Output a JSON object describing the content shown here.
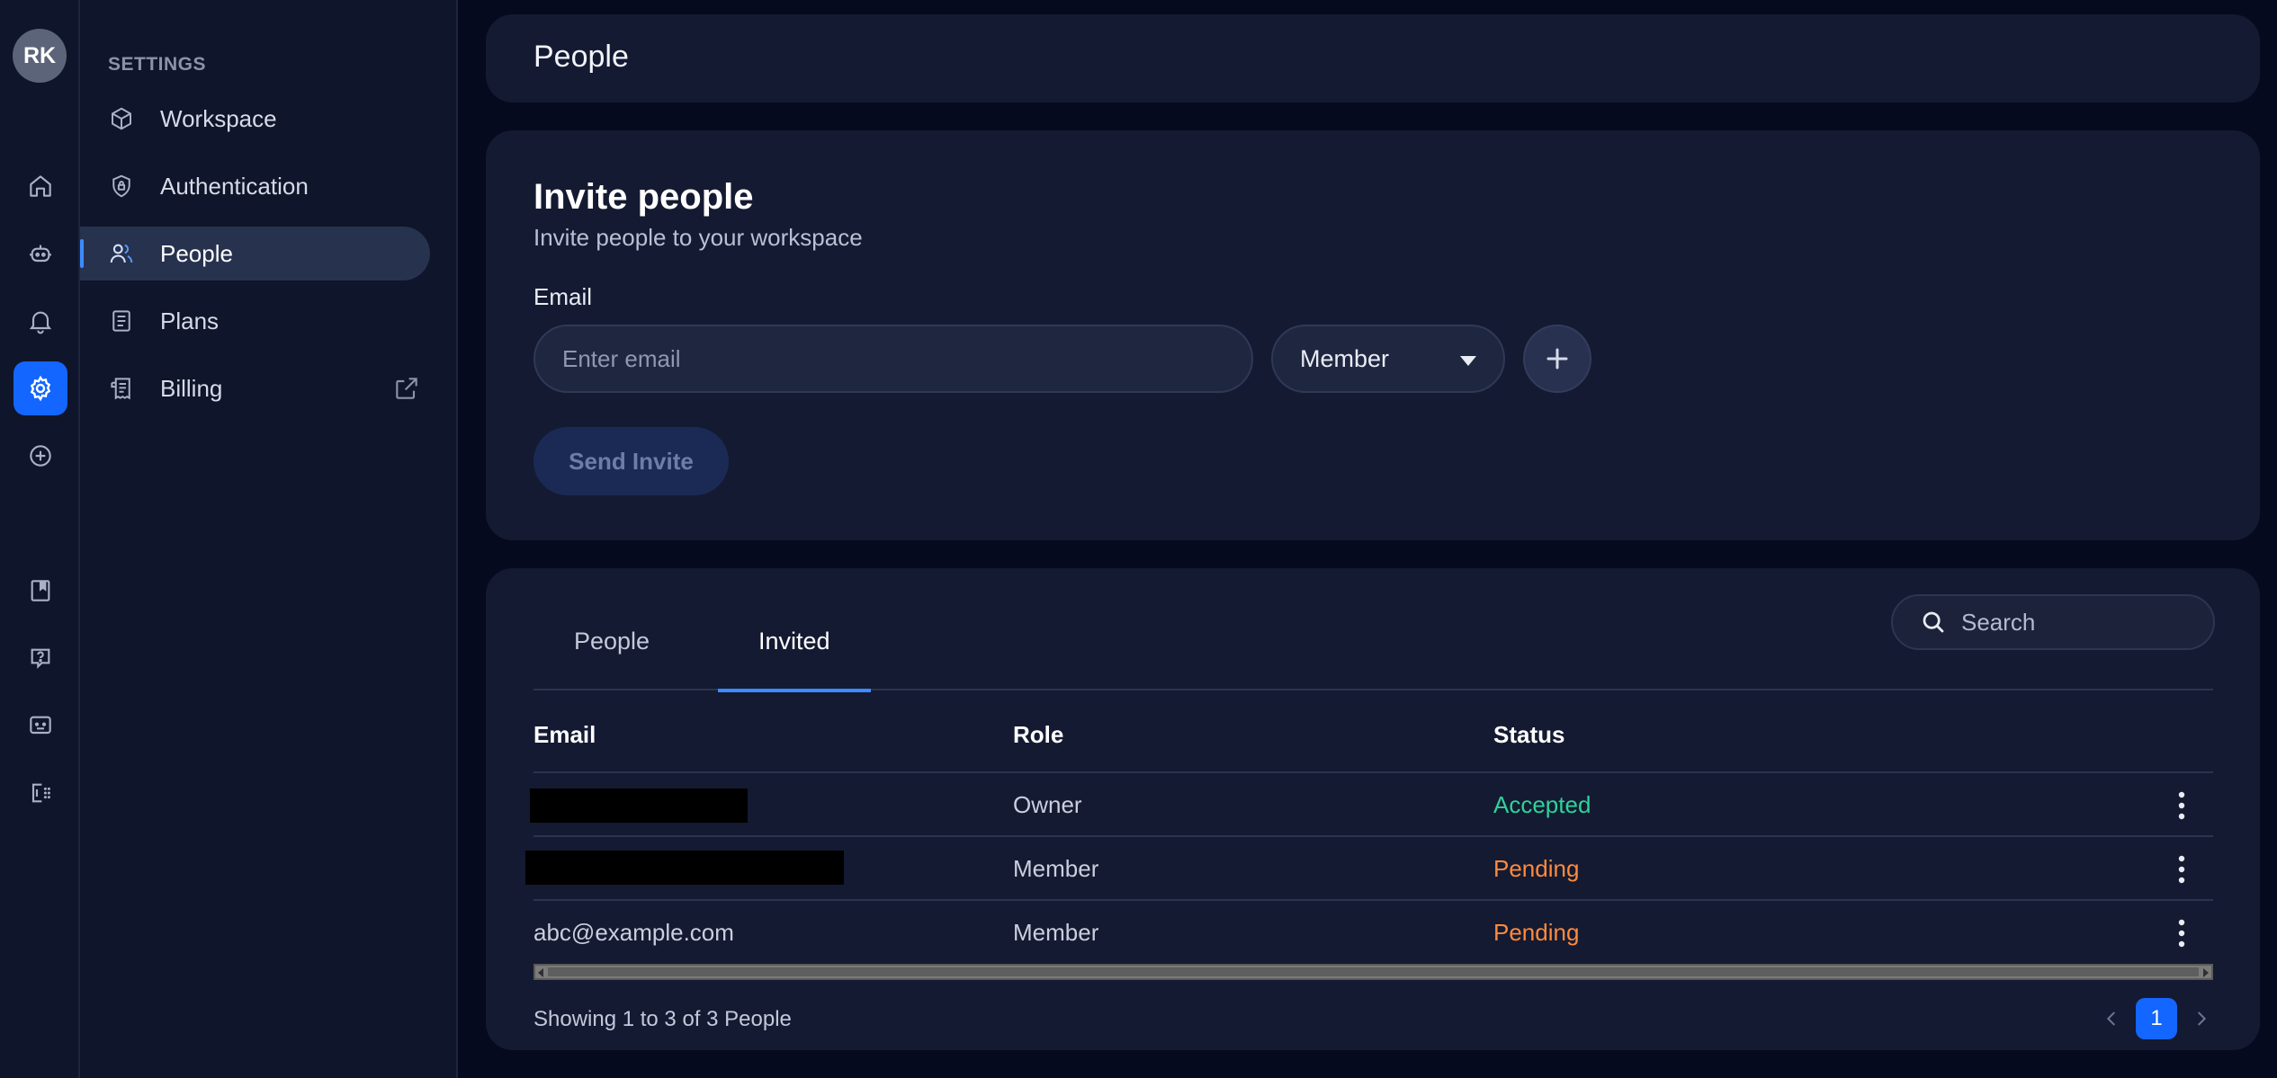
{
  "user": {
    "initials": "RK"
  },
  "rail": {
    "items": [
      {
        "icon": "home-icon"
      },
      {
        "icon": "robot-icon"
      },
      {
        "icon": "bell-icon"
      },
      {
        "icon": "gear-icon",
        "active": true
      },
      {
        "icon": "plus-circle-icon"
      },
      {
        "icon": "book-icon"
      },
      {
        "icon": "help-icon"
      },
      {
        "icon": "chat-icon"
      },
      {
        "icon": "logout-icon"
      }
    ]
  },
  "sidebar": {
    "heading": "SETTINGS",
    "items": [
      {
        "label": "Workspace",
        "icon": "cube-icon"
      },
      {
        "label": "Authentication",
        "icon": "shield-lock-icon"
      },
      {
        "label": "People",
        "icon": "people-icon",
        "active": true
      },
      {
        "label": "Plans",
        "icon": "document-icon"
      },
      {
        "label": "Billing",
        "icon": "receipt-icon",
        "external": "external-link-icon"
      }
    ]
  },
  "header": {
    "title": "People"
  },
  "invite": {
    "heading": "Invite people",
    "subheading": "Invite people to your workspace",
    "email_label": "Email",
    "email_placeholder": "Enter email",
    "role_selected": "Member",
    "send_label": "Send Invite"
  },
  "list": {
    "tabs": [
      "People",
      "Invited"
    ],
    "active_tab": "Invited",
    "search_placeholder": "Search",
    "columns": [
      "Email",
      "Role",
      "Status"
    ],
    "rows": [
      {
        "email": "",
        "role": "Owner",
        "status": "Accepted"
      },
      {
        "email": "",
        "role": "Member",
        "status": "Pending"
      },
      {
        "email": "abc@example.com",
        "role": "Member",
        "status": "Pending"
      }
    ],
    "showing": "Showing 1 to 3 of 3 People",
    "current_page": "1"
  },
  "colors": {
    "accent": "#1366ff",
    "accepted": "#2dd39a",
    "pending": "#ff8a3d"
  }
}
